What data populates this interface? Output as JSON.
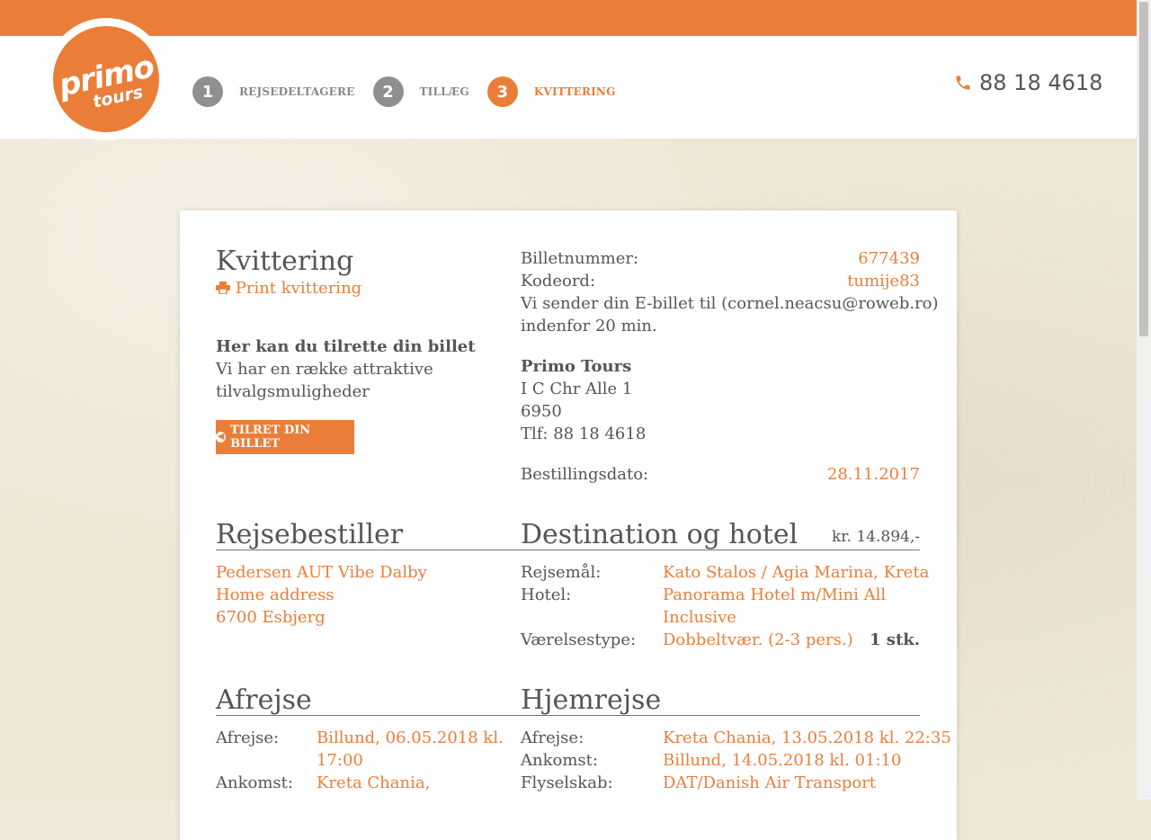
{
  "header": {
    "logo_primary": "primo",
    "logo_secondary": "tours",
    "logo_mark": "*",
    "steps": [
      {
        "num": "1",
        "label": "REJSEDELTAGERE"
      },
      {
        "num": "2",
        "label": "TILLÆG"
      },
      {
        "num": "3",
        "label": "KVITTERING"
      }
    ],
    "phone_icon": "phone-icon",
    "phone": "88 18 4618"
  },
  "receipt": {
    "title": "Kvittering",
    "print_label": "Print kvittering",
    "print_icon": "printer-icon",
    "adjust_heading": "Her kan du tilrette din billet",
    "adjust_text_1": "Vi har en række attraktive",
    "adjust_text_2": "tilvalgsmuligheder",
    "adjust_button": "TILRET DIN BILLET",
    "adjust_button_icon": "arrow-circle-left-icon",
    "ticket_label": "Billetnummer:",
    "ticket_value": "677439",
    "password_label": "Kodeord:",
    "password_value": "tumije83",
    "email_note_1": "Vi sender din E-billet til (cornel.neacsu@roweb.ro)",
    "email_note_2": "indenfor 20 min.",
    "company_name": "Primo Tours",
    "company_street": "I C Chr Alle 1",
    "company_zip": "6950",
    "company_phone": "Tlf: 88 18 4618",
    "order_date_label": "Bestillingsdato:",
    "order_date_value": "28.11.2017"
  },
  "booker": {
    "title": "Rejsebestiller",
    "name": "Pedersen AUT Vibe Dalby",
    "address": "Home address",
    "city": "6700 Esbjerg"
  },
  "destination": {
    "title": "Destination og hotel",
    "price": "kr. 14.894,-",
    "destination_label": "Rejsemål:",
    "destination_value": "Kato Stalos / Agia Marina, Kreta",
    "hotel_label": "Hotel:",
    "hotel_value_1": "Panorama Hotel m/Mini All",
    "hotel_value_2": "Inclusive",
    "room_label": "Værelsestype:",
    "room_value": "Dobbeltvær. (2-3 pers.)",
    "room_qty": "1 stk."
  },
  "outbound": {
    "title": "Afrejse",
    "depart_label": "Afrejse:",
    "depart_value_1": "Billund, 06.05.2018 kl.",
    "depart_value_2": "17:00",
    "arrive_label": "Ankomst:",
    "arrive_value_1": "Kreta Chania,"
  },
  "return": {
    "title": "Hjemrejse",
    "depart_label": "Afrejse:",
    "depart_value": "Kreta Chania, 13.05.2018 kl. 22:35",
    "arrive_label": "Ankomst:",
    "arrive_value": "Billund, 14.05.2018 kl. 01:10",
    "airline_label": "Flyselskab:",
    "airline_value": "DAT/Danish Air Transport"
  }
}
